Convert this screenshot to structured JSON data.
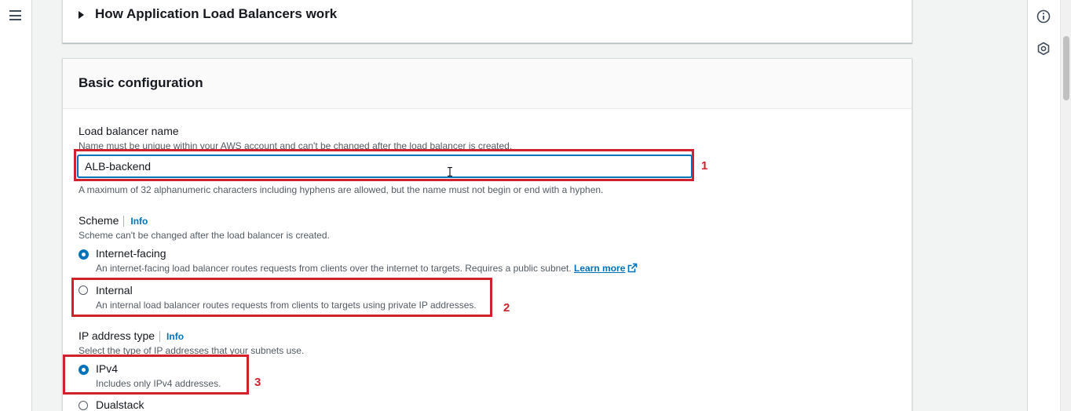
{
  "nav": {
    "menu_icon": "hamburger-menu-icon"
  },
  "right_rail": {
    "icons": [
      "info-circle-icon",
      "hexagon-gear-icon"
    ]
  },
  "how_it_works": {
    "title": "How Application Load Balancers work"
  },
  "basic_config": {
    "title": "Basic configuration",
    "name_field": {
      "label": "Load balancer name",
      "description": "Name must be unique within your AWS account and can't be changed after the load balancer is created.",
      "value": "ALB-backend",
      "constraint": "A maximum of 32 alphanumeric characters including hyphens are allowed, but the name must not begin or end with a hyphen."
    },
    "scheme": {
      "label": "Scheme",
      "info": "Info",
      "description": "Scheme can't be changed after the load balancer is created.",
      "options": [
        {
          "label": "Internet-facing",
          "description": "An internet-facing load balancer routes requests from clients over the internet to targets. Requires a public subnet.",
          "learn_more": "Learn more",
          "selected": true
        },
        {
          "label": "Internal",
          "description": "An internal load balancer routes requests from clients to targets using private IP addresses.",
          "selected": false
        }
      ]
    },
    "ip_type": {
      "label": "IP address type",
      "info": "Info",
      "description": "Select the type of IP addresses that your subnets use.",
      "options": [
        {
          "label": "IPv4",
          "description": "Includes only IPv4 addresses.",
          "selected": true
        },
        {
          "label": "Dualstack",
          "selected": false
        }
      ]
    }
  },
  "annotations": {
    "color": "#d1212d",
    "numbers": [
      "1",
      "2",
      "3"
    ]
  },
  "colors": {
    "link": "#0073bb",
    "radio_selected": "#0073bb",
    "text_primary": "#16191f",
    "text_secondary": "#545b64"
  }
}
